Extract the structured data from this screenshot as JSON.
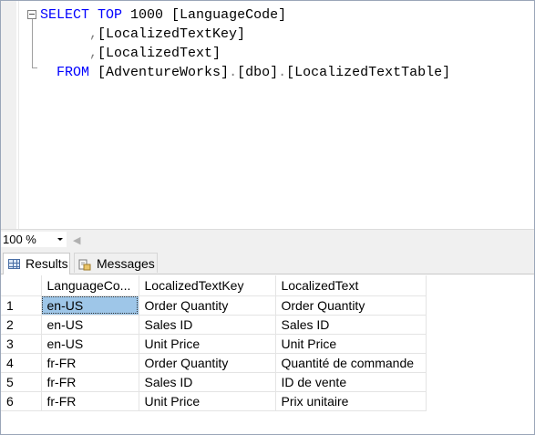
{
  "editor": {
    "lines": [
      {
        "parts": [
          {
            "t": "SELECT",
            "c": "kw"
          },
          {
            "t": " "
          },
          {
            "t": "TOP",
            "c": "kw"
          },
          {
            "t": " 1000 [LanguageCode]"
          }
        ]
      },
      {
        "parts": [
          {
            "t": "      "
          },
          {
            "t": ",",
            "c": "gray"
          },
          {
            "t": "[LocalizedTextKey]"
          }
        ]
      },
      {
        "parts": [
          {
            "t": "      "
          },
          {
            "t": ",",
            "c": "gray"
          },
          {
            "t": "[LocalizedText]"
          }
        ]
      },
      {
        "parts": [
          {
            "t": "  "
          },
          {
            "t": "FROM",
            "c": "kw"
          },
          {
            "t": " [AdventureWorks]"
          },
          {
            "t": ".",
            "c": "gray"
          },
          {
            "t": "[dbo]"
          },
          {
            "t": ".",
            "c": "gray"
          },
          {
            "t": "[LocalizedTextTable]"
          }
        ]
      }
    ]
  },
  "zoom": {
    "value": "100 %"
  },
  "tabs": {
    "results": "Results",
    "messages": "Messages"
  },
  "grid": {
    "columns": [
      "",
      "LanguageCo...",
      "LocalizedTextKey",
      "LocalizedText"
    ],
    "rows": [
      [
        "1",
        "en-US",
        "Order Quantity",
        "Order Quantity"
      ],
      [
        "2",
        "en-US",
        "Sales ID",
        "Sales ID"
      ],
      [
        "3",
        "en-US",
        "Unit Price",
        "Unit Price"
      ],
      [
        "4",
        "fr-FR",
        "Order Quantity",
        "Quantité de commande"
      ],
      [
        "5",
        "fr-FR",
        "Sales ID",
        "ID de vente"
      ],
      [
        "6",
        "fr-FR",
        "Unit Price",
        "Prix unitaire"
      ]
    ]
  },
  "colors": {
    "keyword": "#0000ff",
    "punct": "#808080",
    "selection": "#9ec6e8"
  }
}
